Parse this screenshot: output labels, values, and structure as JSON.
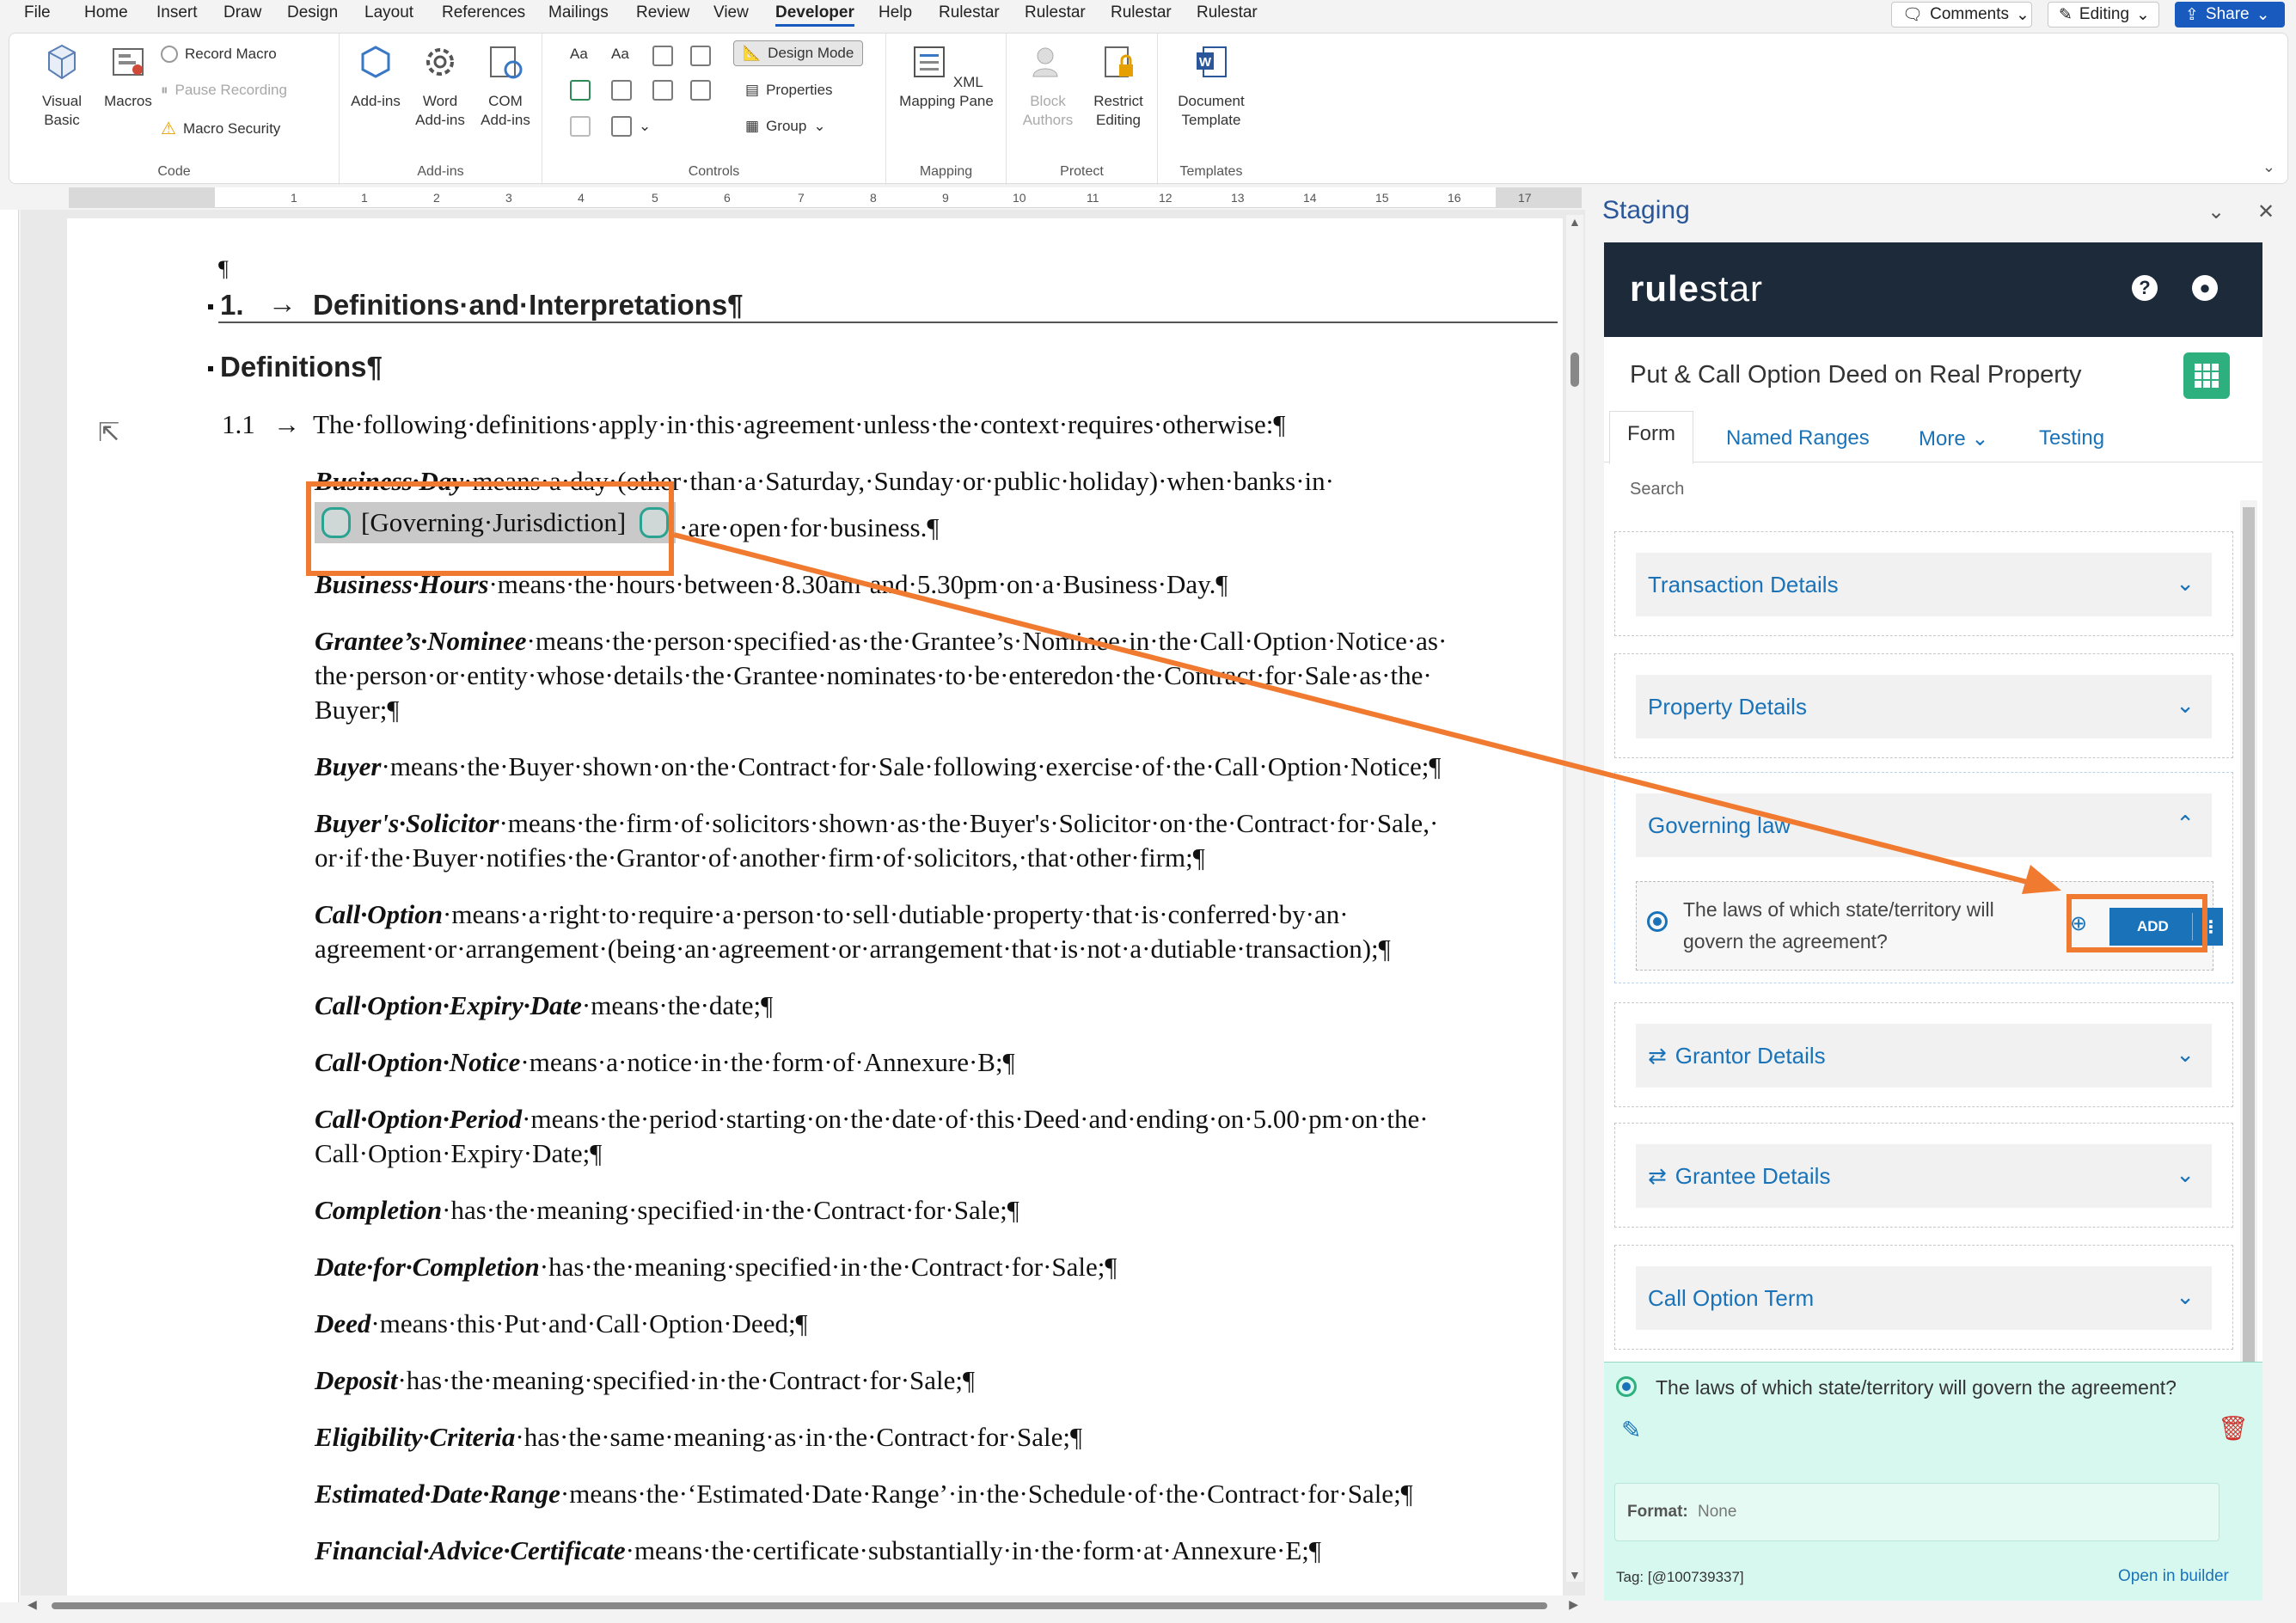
{
  "menu": {
    "tabs": [
      "File",
      "Home",
      "Insert",
      "Draw",
      "Design",
      "Layout",
      "References",
      "Mailings",
      "Review",
      "View",
      "Developer",
      "Help",
      "Rulestar",
      "Rulestar",
      "Rulestar",
      "Rulestar"
    ],
    "active_tab": "Developer",
    "comments_label": "Comments",
    "editing_label": "Editing",
    "share_label": "Share"
  },
  "ribbon": {
    "code": {
      "label": "Code",
      "visual_basic": "Visual Basic",
      "macros": "Macros",
      "record_macro": "Record Macro",
      "pause_recording": "Pause Recording",
      "macro_security": "Macro Security"
    },
    "addins": {
      "label": "Add-ins",
      "addins": "Add-ins",
      "word_addins": "Word Add-ins",
      "com_addins": "COM Add-ins"
    },
    "controls": {
      "label": "Controls",
      "design_mode": "Design Mode",
      "properties": "Properties",
      "group": "Group",
      "aa1": "Aa",
      "aa2": "Aa"
    },
    "mapping": {
      "label": "Mapping",
      "xml_pane": "XML Mapping Pane"
    },
    "protect": {
      "label": "Protect",
      "block_authors": "Block Authors",
      "restrict_editing": "Restrict Editing"
    },
    "templates": {
      "label": "Templates",
      "document_template": "Document Template"
    }
  },
  "ruler": {
    "numbers": [
      "1",
      "1",
      "2",
      "3",
      "4",
      "5",
      "6",
      "7",
      "8",
      "9",
      "10",
      "11",
      "12",
      "13",
      "14",
      "15",
      "16",
      "17"
    ]
  },
  "document": {
    "pilcrow": "¶",
    "heading_number": "1.",
    "heading_arrow": "→",
    "heading_text": "Definitions·and·Interpretations¶",
    "subheading": "Definitions¶",
    "clause_number": "1.1",
    "clause_arrow": "→",
    "clause_text": "The·following·definitions·apply·in·this·agreement·unless·the·context·requires·otherwise:¶",
    "content_control_text": "[Governing·Jurisdiction]",
    "definitions": [
      {
        "term": "Business·Day",
        "lines": [
          "·means·a·day·(other·than·a·Saturday,·Sunday·or·public·holiday)·when·banks·in·"
        ]
      },
      {
        "term": "",
        "lines": [
          "·are·open·for·business.¶"
        ]
      },
      {
        "term": "Business·Hours",
        "lines": [
          "·means·the·hours·between·8.30am·and·5.30pm·on·a·Business·Day.¶"
        ]
      },
      {
        "term": "Grantee’s·Nominee",
        "lines": [
          "·means·the·person·specified·as·the·Grantee’s·Nominee·in·the·Call·Option·Notice·as·",
          "the·person·or·entity·whose·details·the·Grantee·nominates·to·be·enteredon·the·Contract·for·Sale·as·the·",
          "Buyer;¶"
        ]
      },
      {
        "term": "Buyer",
        "lines": [
          "·means·the·Buyer·shown·on·the·Contract·for·Sale·following·exercise·of·the·Call·Option·Notice;¶"
        ]
      },
      {
        "term": "Buyer's·Solicitor",
        "lines": [
          "·means·the·firm·of·solicitors·shown·as·the·Buyer's·Solicitor·on·the·Contract·for·Sale,·",
          "or·if·the·Buyer·notifies·the·Grantor·of·another·firm·of·solicitors,·that·other·firm;¶"
        ]
      },
      {
        "term": "Call·Option",
        "lines": [
          "·means·a·right·to·require·a·person·to·sell·dutiable·property·that·is·conferred·by·an·",
          "agreement·or·arrangement·(being·an·agreement·or·arrangement·that·is·not·a·dutiable·transaction);¶"
        ]
      },
      {
        "term": "Call·Option·Expiry·Date",
        "lines": [
          "·means·the·date;¶"
        ]
      },
      {
        "term": "Call·Option·Notice",
        "lines": [
          "·means·a·notice·in·the·form·of·Annexure·B;¶"
        ]
      },
      {
        "term": "Call·Option·Period",
        "lines": [
          "·means·the·period·starting·on·the·date·of·this·Deed·and·ending·on·5.00·pm·on·the·",
          "Call·Option·Expiry·Date;¶"
        ]
      },
      {
        "term": "Completion",
        "lines": [
          "·has·the·meaning·specified·in·the·Contract·for·Sale;¶"
        ]
      },
      {
        "term": "Date·for·Completion",
        "lines": [
          "·has·the·meaning·specified·in·the·Contract·for·Sale;¶"
        ]
      },
      {
        "term": "Deed",
        "lines": [
          "·means·this·Put·and·Call·Option·Deed;¶"
        ]
      },
      {
        "term": "Deposit",
        "lines": [
          "·has·the·meaning·specified·in·the·Contract·for·Sale;¶"
        ]
      },
      {
        "term": "Eligibility·Criteria",
        "lines": [
          "·has·the·same·meaning·as·in·the·Contract·for·Sale;¶"
        ]
      },
      {
        "term": "Estimated·Date·Range",
        "lines": [
          "·means·the·‘Estimated·Date·Range’·in·the·Schedule·of·the·Contract·for·Sale;¶"
        ]
      },
      {
        "term": "Financial·Advice·Certificate",
        "lines": [
          "·means·the·certificate·substantially·in·the·form·at·Annexure·E;¶"
        ]
      }
    ]
  },
  "pane": {
    "title": "Staging",
    "dropdown_icon": "chevron-down-icon",
    "close_icon": "close-icon",
    "logo_bold": "rule",
    "logo_rest": "star",
    "help_icon": "question-icon",
    "user_icon": "user-icon",
    "deed_title": "Put & Call Option Deed on Real Property",
    "tabs": [
      "Form",
      "Named Ranges",
      "More",
      "Testing"
    ],
    "search_placeholder": "Search",
    "sections": [
      {
        "label": "Transaction Details",
        "repeat": false,
        "open": false
      },
      {
        "label": "Property Details",
        "repeat": false,
        "open": false
      },
      {
        "label": "Governing law",
        "repeat": false,
        "open": true
      },
      {
        "label": "Grantor Details",
        "repeat": true,
        "open": false
      },
      {
        "label": "Grantee Details",
        "repeat": true,
        "open": false
      },
      {
        "label": "Call Option Term",
        "repeat": false,
        "open": false
      }
    ],
    "question": "The laws of which state/territory will govern the agreement?",
    "add_label": "ADD",
    "add_menu": "⋮",
    "detail": {
      "question": "The laws of which state/territory will govern the agreement?",
      "format_label": "Format:",
      "format_value": "None",
      "tag": "Tag: [@100739337]",
      "open_builder": "Open in builder"
    }
  },
  "colors": {
    "accent": "#1a73b8",
    "highlight_box": "#f07a30",
    "brand_dark": "#1d2a3a",
    "detail_bg": "#d7f8ef"
  }
}
